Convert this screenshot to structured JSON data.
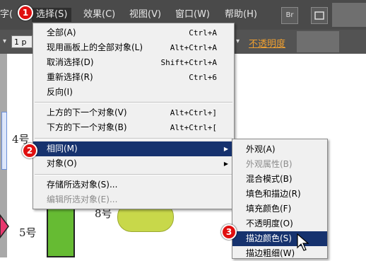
{
  "menubar": {
    "items": [
      "字(",
      "选择(S)",
      "效果(C)",
      "视图(V)",
      "窗口(W)",
      "帮助(H)"
    ],
    "bridge_icon": "Br",
    "arrange_icon": "arrange-documents-icon"
  },
  "controlbar": {
    "stroke_weight": "1 p",
    "opacity_label": "不透明度"
  },
  "canvas": {
    "labels": {
      "obj4": "4号",
      "obj5": "5号",
      "obj8": "8号"
    },
    "colors": {
      "selection": "#6b8fd8",
      "green_bar": "#66bb33",
      "yellow_green_pill": "#c8d84a",
      "pink_shape": "#e8386e"
    }
  },
  "select_menu": {
    "items": [
      {
        "label": "全部(A)",
        "shortcut": "Ctrl+A"
      },
      {
        "label": "现用画板上的全部对象(L)",
        "shortcut": "Alt+Ctrl+A"
      },
      {
        "label": "取消选择(D)",
        "shortcut": "Shift+Ctrl+A"
      },
      {
        "label": "重新选择(R)",
        "shortcut": "Ctrl+6"
      },
      {
        "label": "反向(I)",
        "shortcut": ""
      },
      {
        "label": "上方的下一个对象(V)",
        "shortcut": "Alt+Ctrl+]"
      },
      {
        "label": "下方的下一个对象(B)",
        "shortcut": "Alt+Ctrl+["
      },
      {
        "label": "相同(M)",
        "shortcut": ""
      },
      {
        "label": "对象(O)",
        "shortcut": ""
      },
      {
        "label": "存储所选对象(S)...",
        "shortcut": ""
      },
      {
        "label": "编辑所选对象(E)...",
        "shortcut": ""
      }
    ]
  },
  "same_submenu": {
    "items": [
      {
        "label": "外观(A)"
      },
      {
        "label": "外观属性(B)"
      },
      {
        "label": "混合模式(B)"
      },
      {
        "label": "填色和描边(R)"
      },
      {
        "label": "填充颜色(F)"
      },
      {
        "label": "不透明度(O)"
      },
      {
        "label": "描边颜色(S)"
      },
      {
        "label": "描边粗细(W)"
      }
    ]
  },
  "badges": [
    "1",
    "2",
    "3"
  ],
  "colors": {
    "menubar_bg": "#4a4a4a",
    "highlight": "#16326e",
    "badge_red": "#e01010",
    "opacity_link": "#f0a030"
  }
}
